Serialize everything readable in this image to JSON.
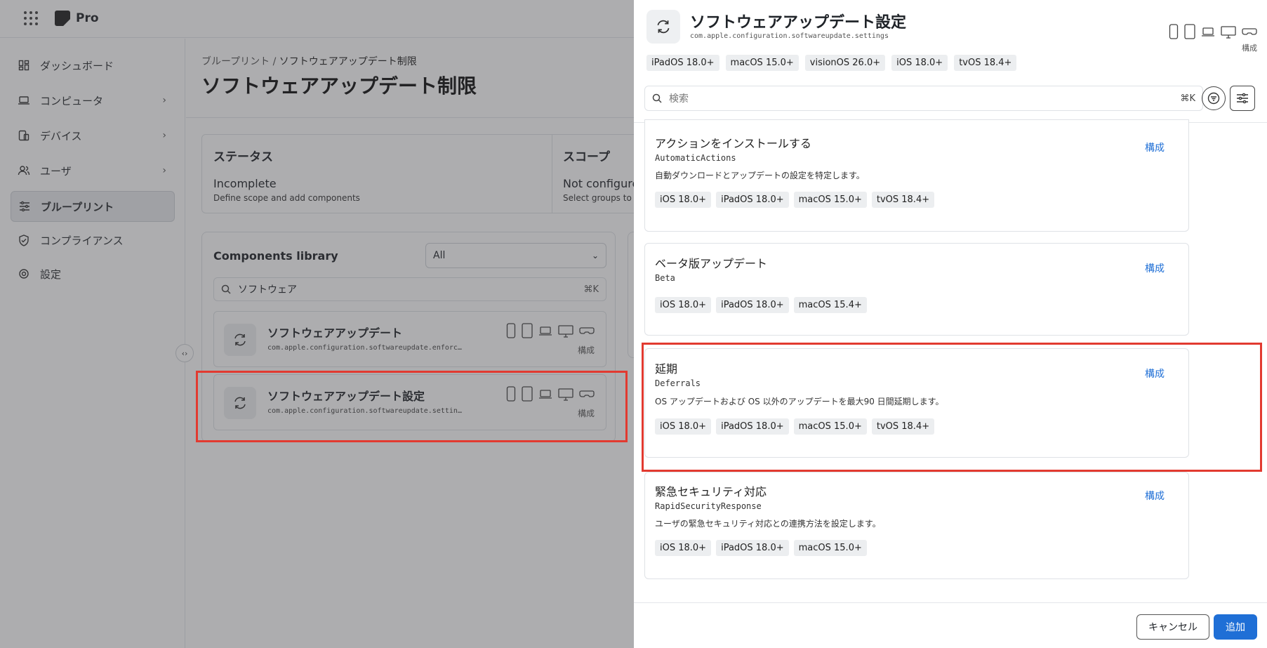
{
  "app": {
    "brand": "Pro",
    "breadcrumb_root": "ブループリント",
    "breadcrumb_sep": " / ",
    "breadcrumb_current": "ソフトウェアアップデート制限",
    "page_title": "ソフトウェアアップデート制限"
  },
  "sidebar": {
    "items": [
      {
        "label": "ダッシュボード",
        "icon": "dashboard-icon"
      },
      {
        "label": "コンピュータ",
        "icon": "laptop-icon"
      },
      {
        "label": "デバイス",
        "icon": "devices-icon"
      },
      {
        "label": "ユーザ",
        "icon": "users-icon"
      },
      {
        "label": "ブループリント",
        "icon": "sliders-icon"
      },
      {
        "label": "コンプライアンス",
        "icon": "shield-check-icon"
      },
      {
        "label": "設定",
        "icon": "gear-icon"
      }
    ]
  },
  "status": {
    "status_title": "ステータス",
    "status_value": "Incomplete",
    "status_sub": "Define scope and add components",
    "scope_title": "スコープ",
    "scope_value": "Not configure",
    "scope_sub": "Select groups to b"
  },
  "library": {
    "title": "Components library",
    "filter_value": "All",
    "search_value": "ソフトウェア",
    "search_kbd": "⌘K",
    "items": [
      {
        "name": "ソフトウェアアップデート",
        "id": "com.apple.configuration.softwareupdate.enforc…",
        "cfg": "構成"
      },
      {
        "name": "ソフトウェアアップデート設定",
        "id": "com.apple.configuration.softwareupdate.settings",
        "cfg": "構成"
      }
    ]
  },
  "panel": {
    "title": "ソフトウェアアップデート設定",
    "subtitle": "com.apple.configuration.softwareupdate.settings",
    "cfg": "構成",
    "platforms": [
      "iPadOS 18.0+",
      "macOS 15.0+",
      "visionOS 26.0+",
      "iOS 18.0+",
      "tvOS 18.4+"
    ],
    "search_placeholder": "検索",
    "search_kbd": "⌘K",
    "cards": [
      {
        "title": "アクションをインストールする",
        "key": "AutomaticActions",
        "desc": "自動ダウンロードとアップデートの設定を特定します。",
        "cfg": "構成",
        "chips": [
          "iOS 18.0+",
          "iPadOS 18.0+",
          "macOS 15.0+",
          "tvOS 18.4+"
        ]
      },
      {
        "title": "ベータ版アップデート",
        "key": "Beta",
        "desc": "",
        "cfg": "構成",
        "chips": [
          "iOS 18.0+",
          "iPadOS 18.0+",
          "macOS 15.4+"
        ]
      },
      {
        "title": "延期",
        "key": "Deferrals",
        "desc": "OS アップデートおよび OS 以外のアップデートを最大90 日間延期します。",
        "cfg": "構成",
        "chips": [
          "iOS 18.0+",
          "iPadOS 18.0+",
          "macOS 15.0+",
          "tvOS 18.4+"
        ]
      },
      {
        "title": "緊急セキュリティ対応",
        "key": "RapidSecurityResponse",
        "desc": "ユーザの緊急セキュリティ対応との連携方法を設定します。",
        "cfg": "構成",
        "chips": [
          "iOS 18.0+",
          "iPadOS 18.0+",
          "macOS 15.0+"
        ]
      }
    ],
    "cancel_label": "キャンセル",
    "add_label": "追加"
  },
  "colors": {
    "accent": "#1f6fd6",
    "highlight": "#e23a30"
  }
}
